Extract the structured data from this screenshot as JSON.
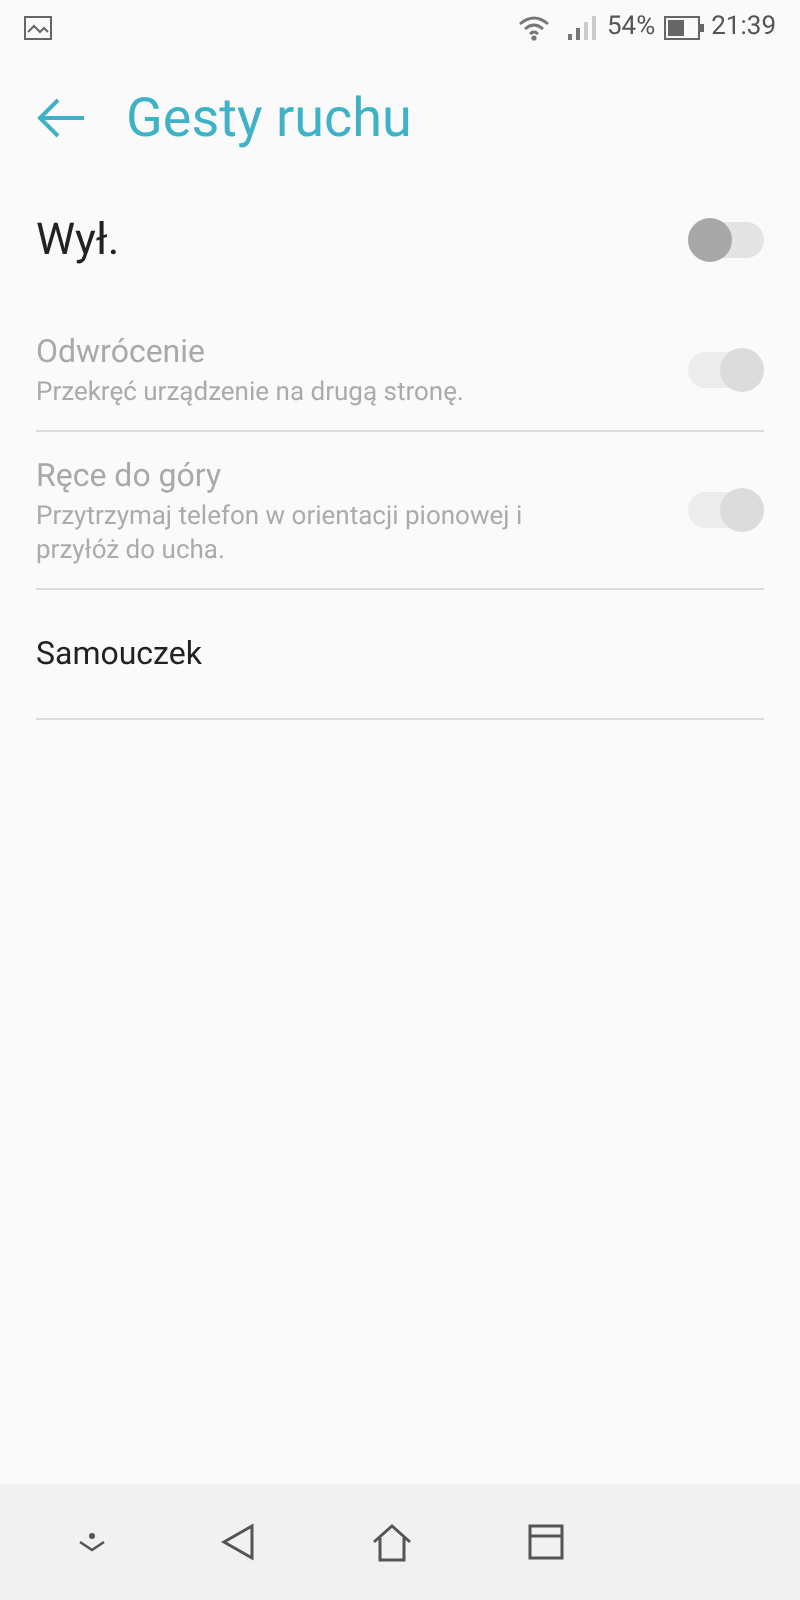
{
  "status_bar": {
    "battery": "54%",
    "time": "21:39"
  },
  "header": {
    "title": "Gesty ruchu"
  },
  "master": {
    "label": "Wył.",
    "on": false
  },
  "items": [
    {
      "kind": "switch",
      "title": "Odwrócenie",
      "subtitle": "Przekręć urządzenie na drugą stronę.",
      "on": true,
      "disabled": true
    },
    {
      "kind": "switch",
      "title": "Ręce do góry",
      "subtitle": "Przytrzymaj telefon w orientacji pionowej i przyłóż do ucha.",
      "on": true,
      "disabled": true
    },
    {
      "kind": "link",
      "title": "Samouczek",
      "disabled": false
    }
  ]
}
